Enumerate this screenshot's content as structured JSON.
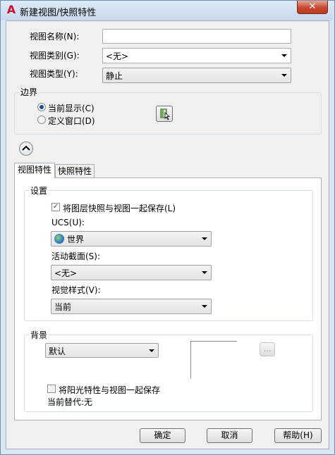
{
  "window": {
    "title": "新建视图/快照特性",
    "close_symbol": "✕",
    "app_symbol": "A"
  },
  "form": {
    "view_name": {
      "label": "视图名称(N):",
      "value": ""
    },
    "view_category": {
      "label": "视图类别(G):",
      "value": "<无>"
    },
    "view_type": {
      "label": "视图类型(Y):",
      "value": "静止"
    }
  },
  "boundary": {
    "title": "边界",
    "current_display": "当前显示(C)",
    "define_window": "定义窗口(D)",
    "selected": "current_display"
  },
  "tabs": [
    {
      "label": "视图特性",
      "active": true
    },
    {
      "label": "快照特性",
      "active": false
    }
  ],
  "settings": {
    "title": "设置",
    "save_layer_snapshot": {
      "label": "将图层快照与视图一起保存(L)",
      "checked": true
    },
    "ucs": {
      "label": "UCS(U):",
      "value": "世界"
    },
    "live_section": {
      "label": "活动截面(S):",
      "value": "<无>"
    },
    "visual_style": {
      "label": "视觉样式(V):",
      "value": "当前"
    }
  },
  "background": {
    "title": "背景",
    "value": "默认",
    "browse_label": "...",
    "save_sun": {
      "label": "将阳光特性与视图一起保存",
      "checked": false
    },
    "current_override": "当前替代:无"
  },
  "buttons": {
    "ok": "确定",
    "cancel": "取消",
    "help": "帮助(H)"
  }
}
